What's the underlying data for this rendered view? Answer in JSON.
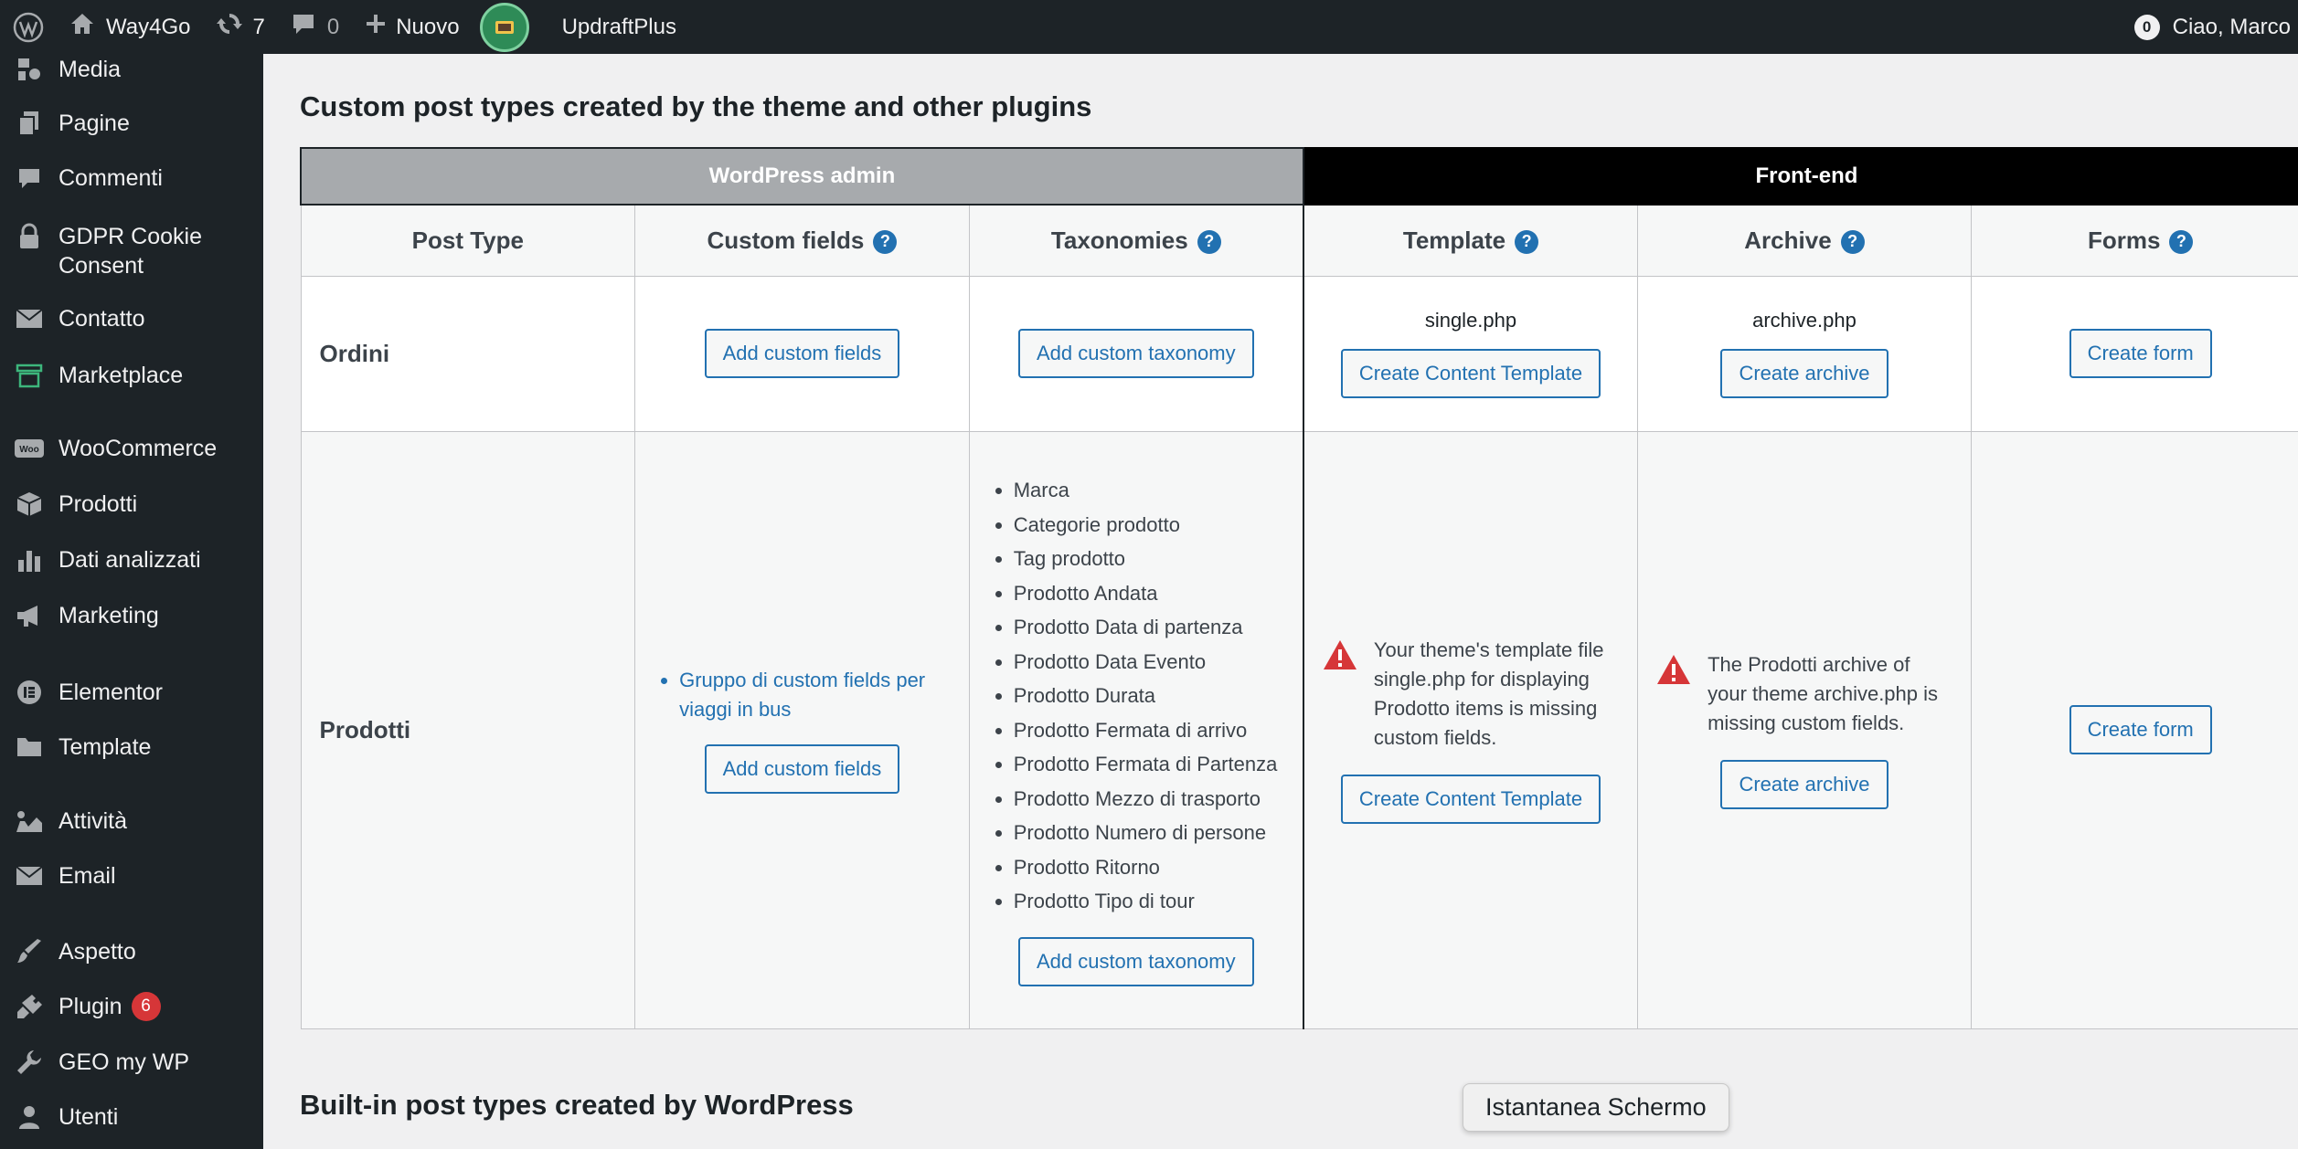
{
  "adminbar": {
    "site_name": "Way4Go",
    "updates_count": "7",
    "comments_count": "0",
    "new_label": "Nuovo",
    "plugin_label": "UpdraftPlus",
    "notifications_count": "0",
    "greeting": "Ciao, Marco"
  },
  "sidebar": {
    "items": [
      {
        "label": "Media"
      },
      {
        "label": "Pagine"
      },
      {
        "label": "Commenti"
      },
      {
        "label": "GDPR Cookie Consent"
      },
      {
        "label": "Contatto"
      },
      {
        "label": "Marketplace"
      },
      {
        "label": "WooCommerce"
      },
      {
        "label": "Prodotti"
      },
      {
        "label": "Dati analizzati"
      },
      {
        "label": "Marketing"
      },
      {
        "label": "Elementor"
      },
      {
        "label": "Template"
      },
      {
        "label": "Attività"
      },
      {
        "label": "Email"
      },
      {
        "label": "Aspetto"
      },
      {
        "label": "Plugin",
        "badge": "6"
      },
      {
        "label": "GEO my WP"
      },
      {
        "label": "Utenti"
      }
    ]
  },
  "main": {
    "section_custom_title": "Custom post types created by the theme and other plugins",
    "section_builtin_title": "Built-in post types created by WordPress",
    "groups": {
      "admin": "WordPress admin",
      "front": "Front-end"
    },
    "columns": {
      "post_type": "Post Type",
      "custom_fields": "Custom fields",
      "taxonomies": "Taxonomies",
      "template": "Template",
      "archive": "Archive",
      "forms": "Forms"
    },
    "help_glyph": "?",
    "rows": {
      "ordini": {
        "name": "Ordini",
        "add_custom_fields": "Add custom fields",
        "add_custom_taxonomy": "Add custom taxonomy",
        "template_file": "single.php",
        "create_content_template": "Create Content Template",
        "archive_file": "archive.php",
        "create_archive": "Create archive",
        "create_form": "Create form"
      },
      "prodotti": {
        "name": "Prodotti",
        "custom_field_group": "Gruppo di custom fields per viaggi in bus",
        "add_custom_fields": "Add custom fields",
        "taxonomies": [
          "Marca",
          "Categorie prodotto",
          "Tag prodotto",
          "Prodotto Andata",
          "Prodotto Data di partenza",
          "Prodotto Data Evento",
          "Prodotto Durata",
          "Prodotto Fermata di arrivo",
          "Prodotto Fermata di Partenza",
          "Prodotto Mezzo di trasporto",
          "Prodotto Numero di persone",
          "Prodotto Ritorno",
          "Prodotto Tipo di tour"
        ],
        "add_custom_taxonomy": "Add custom taxonomy",
        "template_warning": "Your theme's template file single.php for displaying Prodotto items is missing custom fields.",
        "create_content_template": "Create Content Template",
        "archive_warning": "The Prodotti archive of your theme archive.php is missing custom fields.",
        "create_archive": "Create archive",
        "create_form": "Create form"
      }
    }
  },
  "tooltip": {
    "text": "Istantanea Schermo"
  },
  "colors": {
    "admin_bg": "#1d2327",
    "link": "#2271b1",
    "warning": "#d63638",
    "group_admin": "#a7aaad"
  }
}
